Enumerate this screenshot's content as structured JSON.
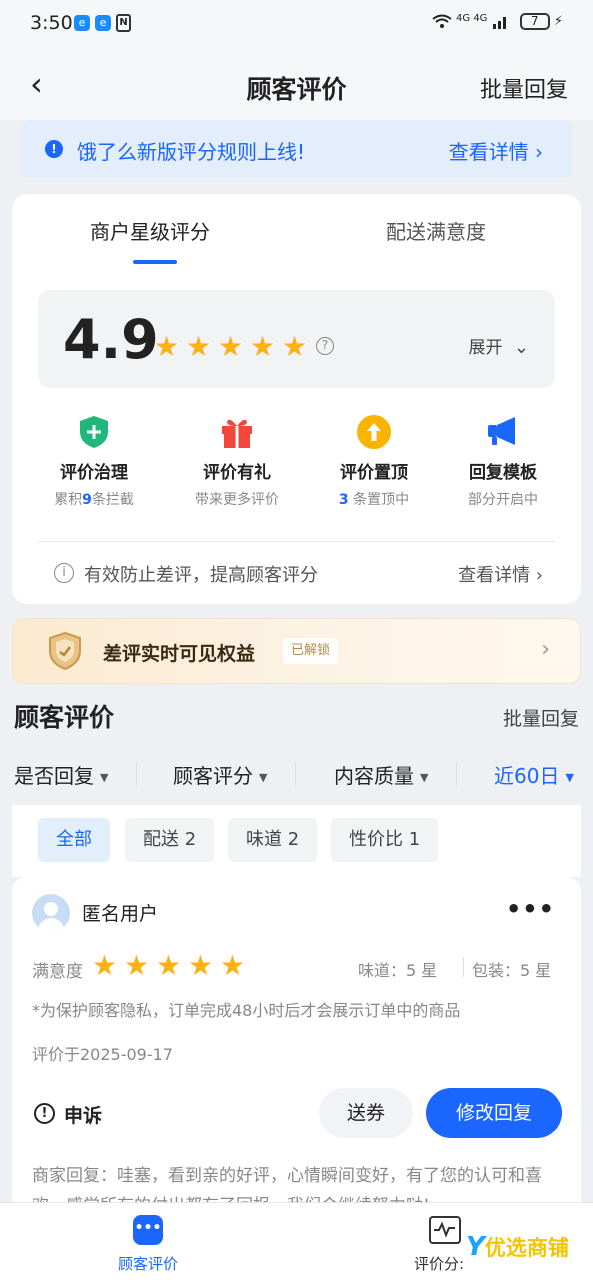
{
  "status_bar": {
    "time": "3:50",
    "app_icon_1": "e",
    "app_icon_2": "e",
    "nfc_label": "N",
    "network": "4G 4G",
    "battery": "7",
    "charging": "⚡"
  },
  "nav": {
    "back": "‹",
    "title": "顾客评价",
    "batch_reply": "批量回复"
  },
  "notice": {
    "icon": "!",
    "text": "饿了么新版评分规则上线!",
    "link": "查看详情 ›"
  },
  "rating_card": {
    "tabs": [
      {
        "label": "商户星级评分"
      },
      {
        "label": "配送满意度"
      }
    ],
    "score": "4.9",
    "stars": [
      "★",
      "★",
      "★",
      "★",
      "★"
    ],
    "help_icon": "?",
    "expand_label": "展开",
    "expand_icon": "⌄",
    "features": [
      {
        "name": "评价治理",
        "desc_prefix": "累积",
        "desc_num": "9",
        "desc_suffix": "条拦截"
      },
      {
        "name": "评价有礼",
        "desc": "带来更多评价"
      },
      {
        "name": "评价置顶",
        "desc_num": "3",
        "desc_suffix": " 条置顶中"
      },
      {
        "name": "回复模板",
        "desc": "部分开启中"
      }
    ],
    "tip_icon": "i",
    "tip_text": "有效防止差评，提高顾客评分",
    "tip_link": "查看详情 ›"
  },
  "benefit_banner": {
    "text": "差评实时可见权益",
    "badge": "已解锁",
    "arrow": "›"
  },
  "reviews": {
    "title": "顾客评价",
    "batch_reply": "批量回复",
    "filters": [
      {
        "label": "是否回复"
      },
      {
        "label": "顾客评分"
      },
      {
        "label": "内容质量"
      },
      {
        "label": "近60日"
      }
    ],
    "caret": "▼",
    "chips": [
      {
        "label": "全部"
      },
      {
        "label": "配送 2"
      },
      {
        "label": "味道 2"
      },
      {
        "label": "性价比 1"
      }
    ],
    "item": {
      "user": "匿名用户",
      "more": "•••",
      "satisfaction_label": "满意度",
      "stars": [
        "★",
        "★",
        "★",
        "★",
        "★"
      ],
      "taste": "味道：5 星",
      "packaging": "包装：5 星",
      "privacy_note": "*为保护顾客隐私，订单完成48小时后才会展示订单中的商品",
      "date": "评价于2025-09-17",
      "appeal_icon": "!",
      "appeal": "申诉",
      "coupon_button": "送券",
      "modify_button": "修改回复",
      "reply": "商家回复：哇塞，看到亲的好评，心情瞬间变好，有了您的认可和喜欢，感觉所有的付出都有了回报，我们会继续努力哒!"
    }
  },
  "bottom_nav": {
    "items": [
      {
        "label": "顾客评价",
        "icon": "•••"
      },
      {
        "label": "评价分:"
      }
    ]
  },
  "watermark": {
    "y": "Y",
    "text": "优选商铺"
  },
  "colors": {
    "accent": "#1a66ff",
    "star": "#fbb216",
    "background": "#eef0f4"
  }
}
